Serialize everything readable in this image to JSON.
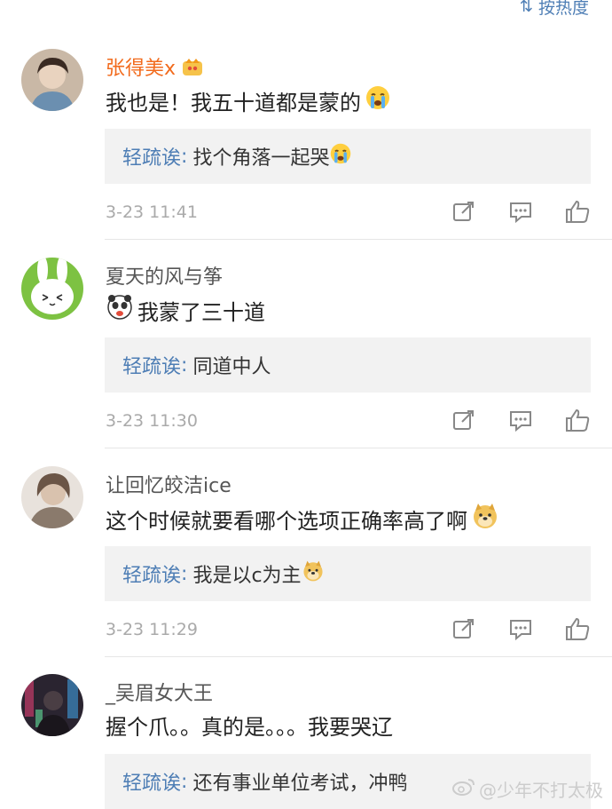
{
  "sort": {
    "label": "按热度"
  },
  "comments": [
    {
      "username": "张得美x",
      "text": "我也是！我五十道都是蒙的",
      "reply_user": "轻疏诶",
      "reply_text": "找个角落一起哭",
      "timestamp": "3-23 11:41"
    },
    {
      "username": "夏天的风与筝",
      "text": "我蒙了三十道",
      "reply_user": "轻疏诶",
      "reply_text": "同道中人",
      "timestamp": "3-23 11:30"
    },
    {
      "username": "让回忆皎洁ice",
      "text": "这个时候就要看哪个选项正确率高了啊",
      "reply_user": "轻疏诶",
      "reply_text": "我是以c为主",
      "timestamp": "3-23 11:29"
    },
    {
      "username": "_吴眉女大王",
      "text": "握个爪。。真的是。。。我要哭辽",
      "reply_user": "轻疏诶",
      "reply_text": "还有事业单位考试，冲鸭"
    }
  ],
  "colon": ":",
  "watermark": "@少年不打太极",
  "colors": {
    "link": "#4e7eb5",
    "vip_name": "#f26b1d",
    "reply_bg": "#f2f2f2",
    "meta": "#aaaaaa"
  }
}
